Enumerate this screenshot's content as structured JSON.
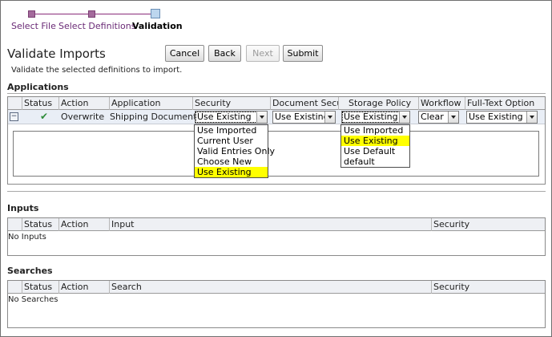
{
  "wizard": {
    "steps": [
      {
        "label": "Select File"
      },
      {
        "label": "Select Definitions"
      },
      {
        "label": "Validation"
      }
    ]
  },
  "page": {
    "title": "Validate Imports",
    "instruction": "Validate the selected definitions to import."
  },
  "toolbar": {
    "cancel_label": "Cancel",
    "back_label": "Back",
    "next_label": "Next",
    "submit_label": "Submit"
  },
  "applications": {
    "title": "Applications",
    "columns": [
      "Status",
      "Action",
      "Application",
      "Security",
      "Document Security",
      "Storage Policy",
      "Workflow",
      "Full-Text Option"
    ],
    "row": {
      "expand_symbol": "−",
      "status_icon": "check-icon",
      "status_glyph": "✔",
      "action": "Overwrite",
      "application": "Shipping Documents",
      "security_value": "Use Existing",
      "document_security_value": "Use Existing",
      "storage_policy_value": "Use Existing",
      "workflow_value": "Clear",
      "full_text_value": "Use Existing"
    },
    "security_dropdown": {
      "options": [
        "Use Imported",
        "Current User",
        "Valid Entries Only",
        "Choose New",
        "Use Existing"
      ],
      "selected": "Use Existing"
    },
    "storage_policy_dropdown": {
      "options": [
        "Use Imported",
        "Use Existing",
        "Use Default",
        "default"
      ],
      "selected": "Use Existing"
    }
  },
  "inputs": {
    "title": "Inputs",
    "columns": [
      "Status",
      "Action",
      "Input",
      "Security"
    ],
    "empty_text": "No Inputs"
  },
  "searches": {
    "title": "Searches",
    "columns": [
      "Status",
      "Action",
      "Search",
      "Security"
    ],
    "empty_text": "No Searches"
  },
  "colors": {
    "highlight": "#ffff00",
    "wizard_link": "#6a2a76",
    "status_ok": "#2e8b3a"
  }
}
